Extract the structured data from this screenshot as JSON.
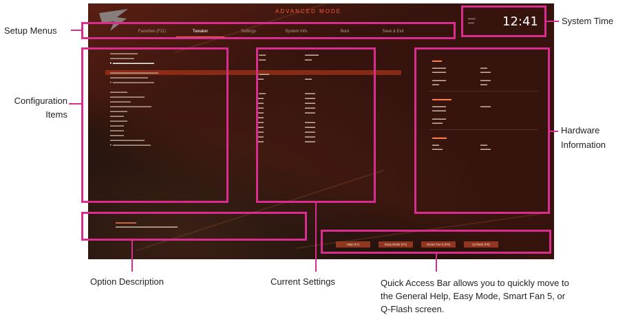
{
  "labels": {
    "setup_menus": "Setup Menus",
    "configuration_items_line1": "Configuration",
    "configuration_items_line2": "Items",
    "system_time": "System Time",
    "hardware_information_line1": "Hardware",
    "hardware_information_line2": "Information",
    "option_description": "Option Description",
    "current_settings": "Current Settings",
    "quick_access_line1": "Quick Access Bar allows you to quickly move to",
    "quick_access_line2": "the General Help, Easy Mode, Smart Fan 5, or",
    "quick_access_line3": "Q-Flash screen."
  },
  "bios": {
    "mode_title": "ADVANCED MODE",
    "clock_time": "12:41",
    "menus": [
      "Favorites (F11)",
      "Tweaker",
      "Settings",
      "System Info.",
      "Boot",
      "Save & Exit"
    ],
    "active_menu_index": 1,
    "quick_access": [
      "Help (F1)",
      "Easy Mode (F2)",
      "Smart Fan 5 (F6)",
      "Q-Flash (F8)"
    ]
  },
  "colors": {
    "annotation": "#d92d8f",
    "accent": "#ff5a3c"
  }
}
